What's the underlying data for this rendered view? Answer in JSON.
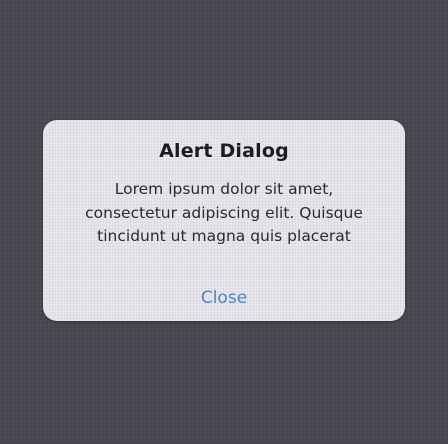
{
  "dialog": {
    "title": "Alert Dialog",
    "message_lines": [
      "Lorem ipsum dolor sit amet,",
      "consectetur adipiscing elit. Quisque",
      "tincidunt ut magna quis placerat"
    ],
    "close_label": "Close"
  },
  "colors": {
    "backdrop": "#46464e",
    "dialog_background": "#e8e8ec",
    "title_text": "#1c1c1e",
    "message_text": "#2b2b2e",
    "close_button_text": "#4a86c7"
  }
}
